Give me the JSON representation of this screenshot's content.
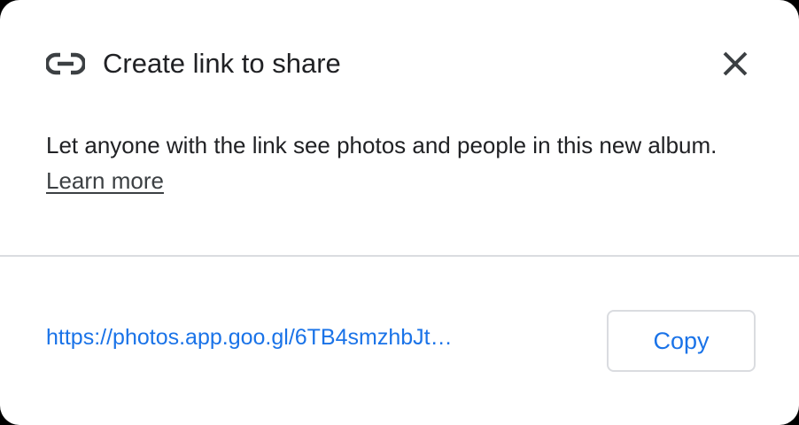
{
  "dialog": {
    "title": "Create link to share",
    "title_icon": "link-icon",
    "close_icon": "close-icon",
    "description": "Let anyone with the link see photos and people in this new album.",
    "learn_more_label": "Learn more",
    "share_url": "https://photos.app.goo.gl/6TB4smzhbJt…",
    "copy_label": "Copy"
  },
  "colors": {
    "accent": "#1a73e8",
    "text": "#202124",
    "divider": "#dadce0"
  }
}
